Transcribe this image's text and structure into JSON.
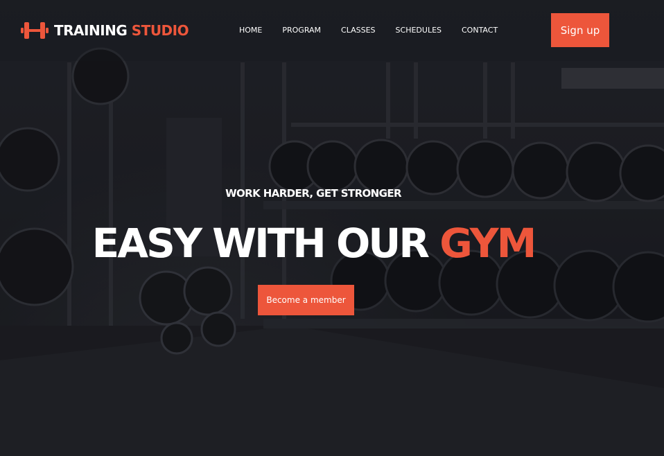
{
  "brand": {
    "name_main": "TRAINING",
    "name_accent": "STUDIO",
    "icon": "dumbbell-icon",
    "accent_color": "#ed563b"
  },
  "nav": {
    "items": [
      {
        "label": "HOME"
      },
      {
        "label": "PROGRAM"
      },
      {
        "label": "CLASSES"
      },
      {
        "label": "SCHEDULES"
      },
      {
        "label": "CONTACT"
      }
    ],
    "signup_label": "Sign up"
  },
  "hero": {
    "kicker": "WORK HARDER, GET STRONGER",
    "headline_main": "EASY WITH OUR",
    "headline_accent": "GYM",
    "cta_label": "Become a member"
  }
}
